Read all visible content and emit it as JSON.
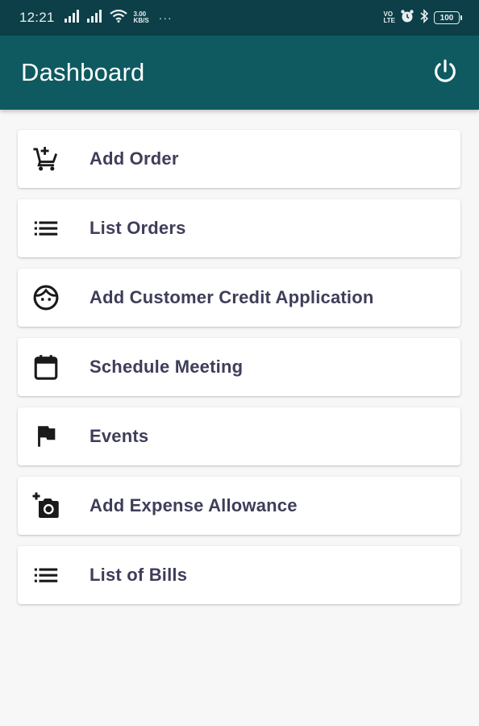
{
  "status_bar": {
    "time": "12:21",
    "network_speed_value": "3.00",
    "network_speed_unit": "KB/S",
    "overflow": "···",
    "volte_top": "VO",
    "volte_bottom": "LTE",
    "battery": "100"
  },
  "app_bar": {
    "title": "Dashboard",
    "power_icon": "power-icon"
  },
  "menu": {
    "items": [
      {
        "label": "Add Order",
        "icon": "add-cart-icon"
      },
      {
        "label": "List Orders",
        "icon": "list-icon"
      },
      {
        "label": "Add Customer Credit Application",
        "icon": "face-icon"
      },
      {
        "label": "Schedule Meeting",
        "icon": "calendar-icon"
      },
      {
        "label": "Events",
        "icon": "flag-icon"
      },
      {
        "label": "Add Expense Allowance",
        "icon": "add-camera-icon"
      },
      {
        "label": "List of Bills",
        "icon": "list-icon"
      }
    ]
  },
  "colors": {
    "status_bar": "#0c3f47",
    "app_bar": "#0e5a60",
    "background": "#f7f7f8",
    "card": "#ffffff",
    "label_text": "#3e3e5a",
    "icon": "#1a1a1a"
  }
}
